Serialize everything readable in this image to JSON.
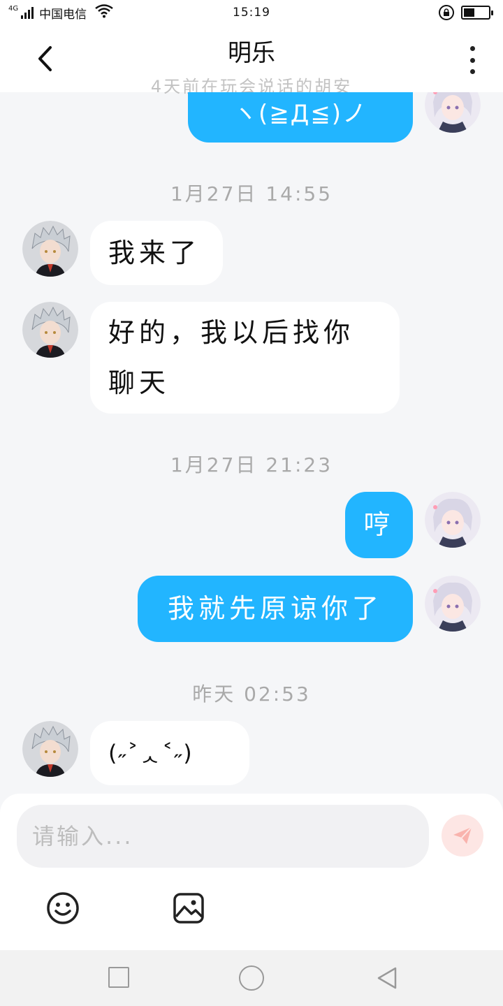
{
  "status_bar": {
    "network": "4G",
    "carrier": "中国电信",
    "time": "15:19",
    "battery_level": 0.45
  },
  "header": {
    "title": "明乐",
    "subtitle": "4天前在玩会说话的胡安"
  },
  "messages": {
    "top_partial": {
      "text": "ヽ(≧Д≦)ノ"
    },
    "ts1": "1月27日 14:55",
    "m1": {
      "text": "我来了"
    },
    "m2": {
      "line1": "好的，我以后找你",
      "line2": "聊天"
    },
    "ts2": "1月27日 21:23",
    "m3": {
      "text": "哼"
    },
    "m4": {
      "text": "我就先原谅你了"
    },
    "ts3": "昨天 02:53",
    "m5": {
      "text": "(˶˃ᆺ˂˶)"
    }
  },
  "input": {
    "placeholder": "请输入..."
  },
  "colors": {
    "outgoing_bubble": "#22b5ff",
    "incoming_bubble": "#ffffff",
    "background": "#f5f6f8",
    "send_button": "#f9b3ad"
  },
  "icons": {
    "back": "chevron-left-icon",
    "more": "more-vertical-icon",
    "send": "paper-plane-icon",
    "emoji": "smiley-icon",
    "image": "image-icon"
  }
}
